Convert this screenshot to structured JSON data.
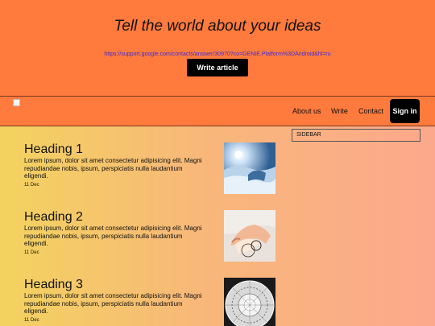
{
  "hero": {
    "title": "Tell the world about your ideas",
    "link": "https://support.google.com/contacts/answer/30970?co=GENIE.Platform%3DAndroid&hl=ru",
    "button": "Write article"
  },
  "nav": {
    "items": [
      {
        "label": "About us"
      },
      {
        "label": "Write"
      },
      {
        "label": "Contact"
      }
    ],
    "signin": "Sign in"
  },
  "sidebar": {
    "label": "SIDEBAR"
  },
  "articles": [
    {
      "heading": "Heading 1",
      "body": "Lorem ipsum, dolor sit amet consectetur adipisicing elit. Magni repudiandae nobis, ipsum, perspiciatis nulla laudantium eligendi.",
      "date": "11 Dec"
    },
    {
      "heading": "Heading 2",
      "body": "Lorem ipsum, dolor sit amet consectetur adipisicing elit. Magni repudiandae nobis, ipsum, perspiciatis nulla laudantium eligendi.",
      "date": "11 Dec"
    },
    {
      "heading": "Heading 3",
      "body": "Lorem ipsum, dolor sit amet consectetur adipisicing elit. Magni repudiandae nobis, ipsum, perspiciatis nulla laudantium eligendi.",
      "date": "11 Dec"
    }
  ],
  "colors": {
    "hero_bg": "#ff7a3d",
    "button_bg": "#000000",
    "link": "#3b2bd6"
  }
}
